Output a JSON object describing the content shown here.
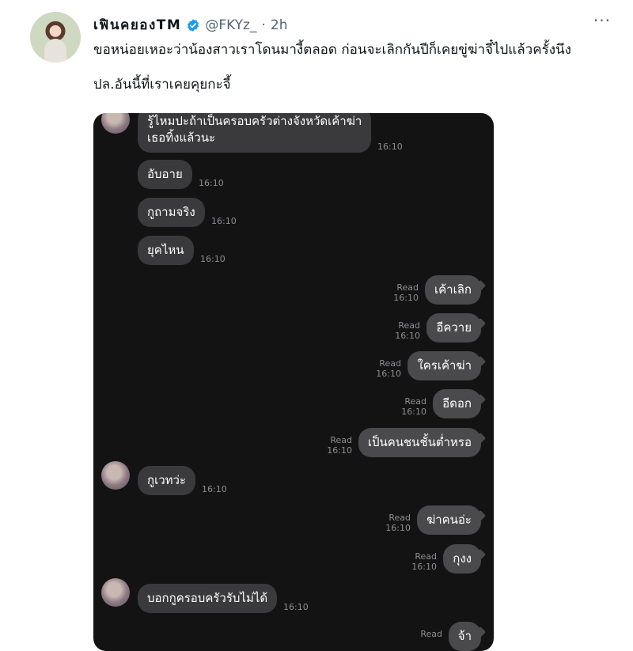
{
  "tweet": {
    "display_name": "เฟินคยองTM",
    "handle": "@FKYz_",
    "separator": "·",
    "time": "2h",
    "more_glyph": "···",
    "lines": [
      "ขอหน่อยเหอะว่าน้องสาวเราโดนมางี้ตลอด ก่อนจะเลิกกันปีก็เคยขู่ฆ่าจี๋ไปแล้วครั้งนึง",
      "ปล.อันนี้ที่เราเคยคุยกะจี้"
    ]
  },
  "chat": {
    "messages": [
      {
        "dir": "in",
        "text": "รู้ไหมปะถ้าเป็นครอบครัวต่างจังหวัดเค้าฆ่า\nเธอทิ้งแล้วนะ",
        "time": "16:10"
      },
      {
        "dir": "in",
        "text": "อับอาย",
        "time": "16:10"
      },
      {
        "dir": "in",
        "text": "กูถามจริง",
        "time": "16:10"
      },
      {
        "dir": "in",
        "text": "ยุคไหน",
        "time": "16:10"
      },
      {
        "dir": "out",
        "text": "เค้าเลิก",
        "read": "Read",
        "time": "16:10"
      },
      {
        "dir": "out",
        "text": "อีควาย",
        "read": "Read",
        "time": "16:10"
      },
      {
        "dir": "out",
        "text": "ใครเค้าฆ่า",
        "read": "Read",
        "time": "16:10"
      },
      {
        "dir": "out",
        "text": "อีดอก",
        "read": "Read",
        "time": "16:10"
      },
      {
        "dir": "out",
        "text": "เป็นคนชนชั้นต่ำหรอ",
        "read": "Read",
        "time": "16:10"
      },
      {
        "dir": "in",
        "text": "กูเวทว่ะ",
        "time": "16:10"
      },
      {
        "dir": "out",
        "text": "ฆ่าคนอ่ะ",
        "read": "Read",
        "time": "16:10"
      },
      {
        "dir": "out",
        "text": "กุงง",
        "read": "Read",
        "time": "16:10"
      },
      {
        "dir": "in",
        "text": "บอกกูครอบครัวรับไม่ได้",
        "time": "16:10"
      },
      {
        "dir": "out",
        "text": "จ้า",
        "read": "Read",
        "time": ""
      }
    ]
  }
}
